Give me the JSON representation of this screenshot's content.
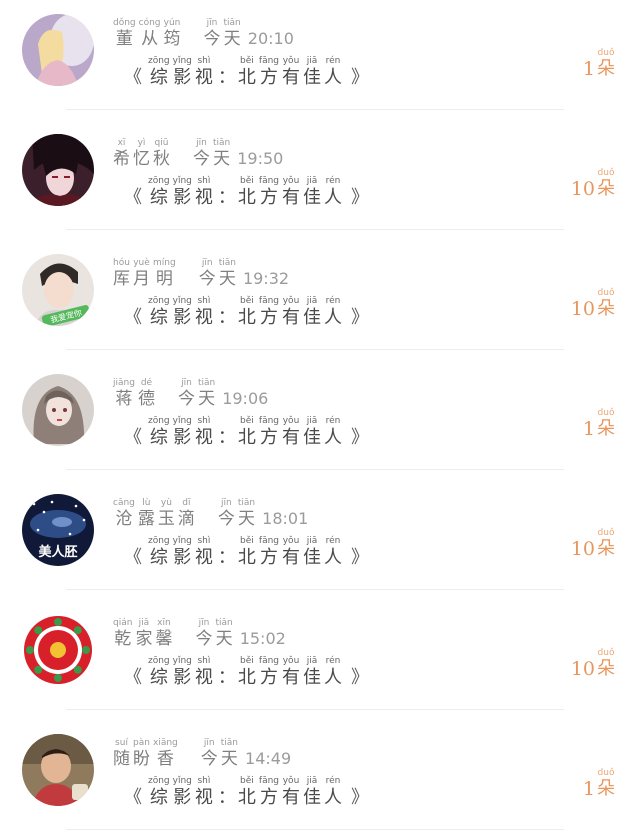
{
  "program": {
    "bracket_open": "《",
    "bracket_close": "》",
    "colon": "：",
    "chars": [
      {
        "py": "zōng",
        "hz": "综"
      },
      {
        "py": "yǐng",
        "hz": "影"
      },
      {
        "py": "shì",
        "hz": "视"
      },
      {
        "py": "běi",
        "hz": "北"
      },
      {
        "py": "fāng",
        "hz": "方"
      },
      {
        "py": "yǒu",
        "hz": "有"
      },
      {
        "py": "jiā",
        "hz": "佳"
      },
      {
        "py": "rén",
        "hz": "人"
      }
    ]
  },
  "today": [
    {
      "py": "jīn",
      "hz": "今"
    },
    {
      "py": "tiān",
      "hz": "天"
    }
  ],
  "unit": {
    "py": "duǒ",
    "hz": "朵"
  },
  "rows": [
    {
      "name": [
        {
          "py": "dǒng",
          "hz": "董"
        },
        {
          "py": "cóng",
          "hz": "从"
        },
        {
          "py": "yún",
          "hz": "筠"
        }
      ],
      "time": "20:10",
      "count": "1",
      "avatar": "girl-with-horse"
    },
    {
      "name": [
        {
          "py": "xī",
          "hz": "希"
        },
        {
          "py": "yì",
          "hz": "忆"
        },
        {
          "py": "qiū",
          "hz": "秋"
        }
      ],
      "time": "19:50",
      "count": "10",
      "avatar": "anime-man-dark"
    },
    {
      "name": [
        {
          "py": "hóu",
          "hz": "厍"
        },
        {
          "py": "yuè",
          "hz": "月"
        },
        {
          "py": "míng",
          "hz": "明"
        }
      ],
      "time": "19:32",
      "count": "10",
      "avatar": "young-man-photo"
    },
    {
      "name": [
        {
          "py": "jiāng",
          "hz": "蒋"
        },
        {
          "py": "dé",
          "hz": "德"
        }
      ],
      "time": "19:06",
      "count": "1",
      "avatar": "anime-girl-grey"
    },
    {
      "name": [
        {
          "py": "cāng",
          "hz": "沧"
        },
        {
          "py": "lù",
          "hz": "露"
        },
        {
          "py": "yù",
          "hz": "玉"
        },
        {
          "py": "dī",
          "hz": "滴"
        }
      ],
      "time": "18:01",
      "count": "10",
      "avatar": "night-sky-text"
    },
    {
      "name": [
        {
          "py": "qián",
          "hz": "乾"
        },
        {
          "py": "jiā",
          "hz": "家"
        },
        {
          "py": "xīn",
          "hz": "馨"
        }
      ],
      "time": "15:02",
      "count": "10",
      "avatar": "red-papercut"
    },
    {
      "name": [
        {
          "py": "suí",
          "hz": "随"
        },
        {
          "py": "pàn",
          "hz": "盼"
        },
        {
          "py": "xiāng",
          "hz": "香"
        }
      ],
      "time": "14:49",
      "count": "1",
      "avatar": "child-photo"
    }
  ],
  "avatar_text": {
    "young-man-photo": "我爱宠你",
    "night-sky-text": "美人胚"
  }
}
